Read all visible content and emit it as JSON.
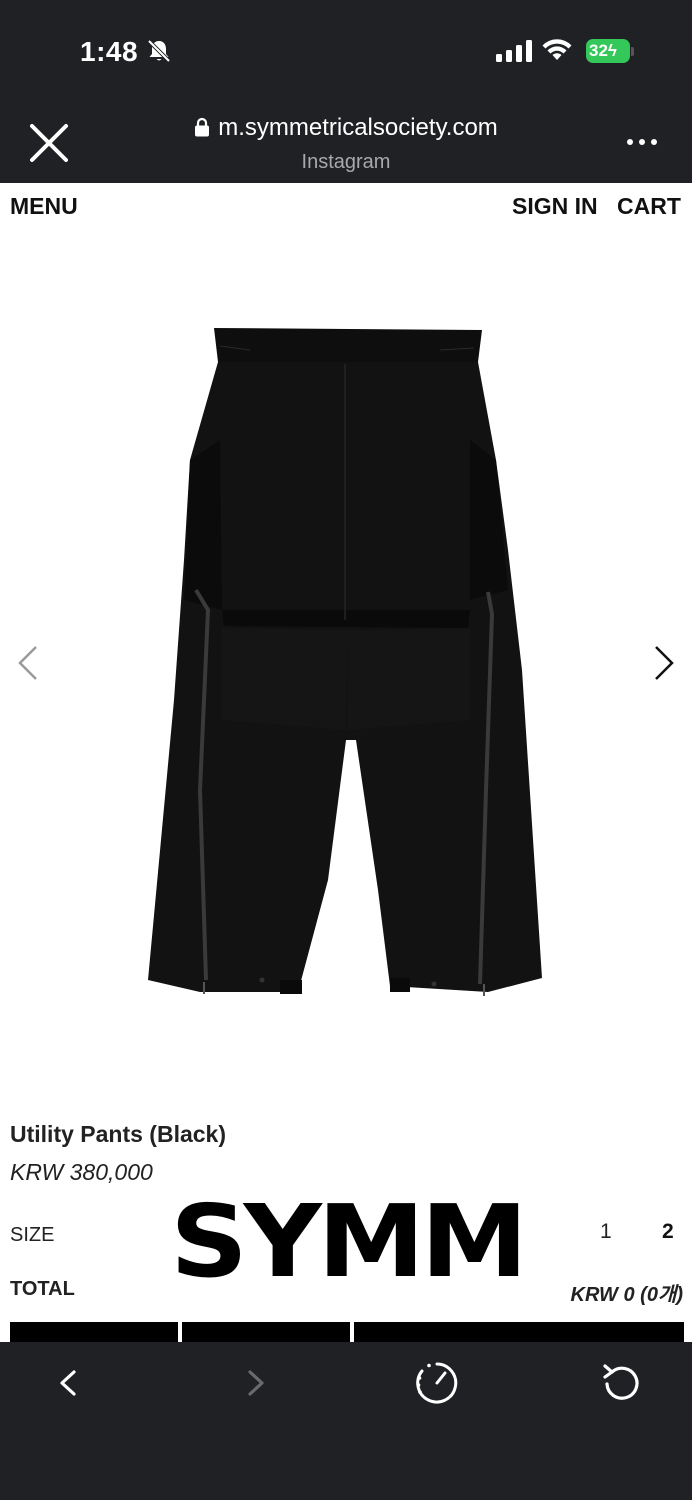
{
  "status_bar": {
    "time": "1:48",
    "battery": "32"
  },
  "browser": {
    "url": "m.symmetricalsociety.com",
    "source": "Instagram"
  },
  "site_nav": {
    "menu": "MENU",
    "sign_in": "SIGN IN",
    "cart": "CART"
  },
  "product": {
    "name": "Utility Pants (Black)",
    "price": "KRW 380,000",
    "size_label": "SIZE",
    "sizes": [
      "1",
      "2"
    ],
    "selected_size": "2",
    "total_label": "TOTAL",
    "total_value": "KRW 0 (0개)"
  },
  "brand": {
    "wordmark": "SYMM"
  },
  "icons": {
    "bell": "bell-slash-icon",
    "close": "close-icon",
    "lock": "lock-icon",
    "more": "more-icon",
    "prev": "chevron-left-icon",
    "next": "chevron-right-icon",
    "back": "back-icon",
    "forward": "forward-icon",
    "speed": "speedometer-icon",
    "refresh": "refresh-icon"
  },
  "colors": {
    "chrome_bg": "#202124",
    "battery": "#34c759",
    "text": "#111111"
  }
}
